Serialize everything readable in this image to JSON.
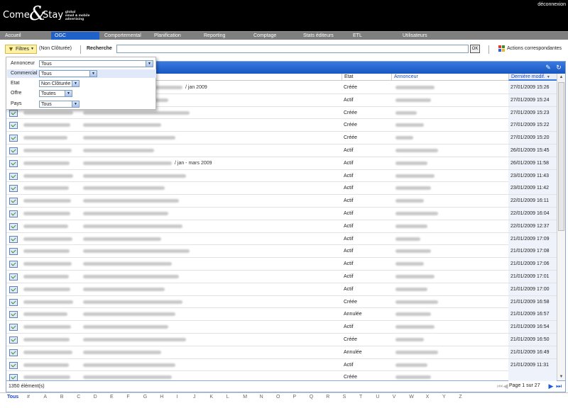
{
  "header": {
    "logo_part1": "Come",
    "logo_amp": "&",
    "logo_part2": "Stay",
    "logo_tag1": "global",
    "logo_tag2": "email & mobile",
    "logo_tag3": "advertising",
    "logout": "déconnexion"
  },
  "nav": {
    "items": [
      {
        "label": "Accueil"
      },
      {
        "label": "OGC"
      },
      {
        "label": "Comportemental"
      },
      {
        "label": "Planification"
      },
      {
        "label": "Reporting"
      },
      {
        "label": "Comptage"
      },
      {
        "label": "Stats éditeurs"
      },
      {
        "label": "ETL"
      },
      {
        "label": "Utilisateurs"
      }
    ],
    "active_index": 1
  },
  "toolbar": {
    "filters_label": "Filtres",
    "filter_state": "(Non Clôturée)",
    "search_label": "Recherche",
    "search_value": "",
    "ok_label": "OK",
    "actions_label": "Actions correspondantes"
  },
  "filter_panel": {
    "annonceur_label": "Annonceur",
    "annonceur_value": "Tous",
    "commercial_label": "Commercial",
    "commercial_value": "Tous",
    "etat_label": "Etat",
    "etat_value": "Non Clôturée",
    "offre_label": "Offre",
    "offre_value": "Toutes",
    "pays_label": "Pays",
    "pays_value": "Tous"
  },
  "grid": {
    "columns": {
      "etat": "Etat",
      "annonceur": "Annonceur",
      "date": "Dernière modif."
    },
    "rows": [
      {
        "name_visible": "/ jan 2009",
        "etat": "Créée",
        "date": "27/01/2009 15:26"
      },
      {
        "name_visible": "",
        "etat": "Actif",
        "date": "27/01/2009 15:24"
      },
      {
        "name_visible": "",
        "etat": "Créée",
        "date": "27/01/2009 15:23"
      },
      {
        "name_visible": "",
        "etat": "Créée",
        "date": "27/01/2009 15:22"
      },
      {
        "name_visible": "",
        "etat": "Créée",
        "date": "27/01/2009 15:20"
      },
      {
        "name_visible": "",
        "etat": "Actif",
        "date": "26/01/2009 15:45"
      },
      {
        "name_visible": "/ jan - mars 2009",
        "etat": "Actif",
        "date": "26/01/2009 11:58"
      },
      {
        "name_visible": "",
        "etat": "Actif",
        "date": "23/01/2009 11:43"
      },
      {
        "name_visible": "",
        "etat": "Actif",
        "date": "23/01/2009 11:42"
      },
      {
        "name_visible": "",
        "etat": "Actif",
        "date": "22/01/2009 16:11"
      },
      {
        "name_visible": "",
        "etat": "Actif",
        "date": "22/01/2009 16:04"
      },
      {
        "name_visible": "",
        "etat": "Actif",
        "date": "22/01/2009 12:37"
      },
      {
        "name_visible": "",
        "etat": "Actif",
        "date": "21/01/2009 17:09"
      },
      {
        "name_visible": "",
        "etat": "Actif",
        "date": "21/01/2009 17:08"
      },
      {
        "name_visible": "",
        "etat": "Actif",
        "date": "21/01/2009 17:06"
      },
      {
        "name_visible": "",
        "etat": "Actif",
        "date": "21/01/2009 17:01"
      },
      {
        "name_visible": "",
        "etat": "Actif",
        "date": "21/01/2009 17:00"
      },
      {
        "name_visible": "",
        "etat": "Créée",
        "date": "21/01/2009 16:58"
      },
      {
        "name_visible": "",
        "etat": "Annulée",
        "date": "21/01/2009 16:57"
      },
      {
        "name_visible": "",
        "etat": "Actif",
        "date": "21/01/2009 16:54"
      },
      {
        "name_visible": "",
        "etat": "Créée",
        "date": "21/01/2009 16:50"
      },
      {
        "name_visible": "",
        "etat": "Annulée",
        "date": "21/01/2009 16:49"
      },
      {
        "name_visible": "",
        "etat": "Actif",
        "date": "21/01/2009 11:31"
      },
      {
        "name_visible": "",
        "etat": "Créée",
        "date": ""
      }
    ]
  },
  "footer": {
    "count": "1350 élément(s)",
    "page_info": "Page 1 sur 27"
  },
  "alphabet": {
    "items": [
      "Tous",
      "#",
      "A",
      "B",
      "C",
      "D",
      "E",
      "F",
      "G",
      "H",
      "I",
      "J",
      "K",
      "L",
      "M",
      "N",
      "O",
      "P",
      "Q",
      "R",
      "S",
      "T",
      "U",
      "V",
      "W",
      "X",
      "Y",
      "Z"
    ],
    "active_index": 0
  },
  "colors": {
    "accent": "#1e61c8",
    "header_bg": "#000000",
    "nav_bg": "#7f7f7f"
  }
}
